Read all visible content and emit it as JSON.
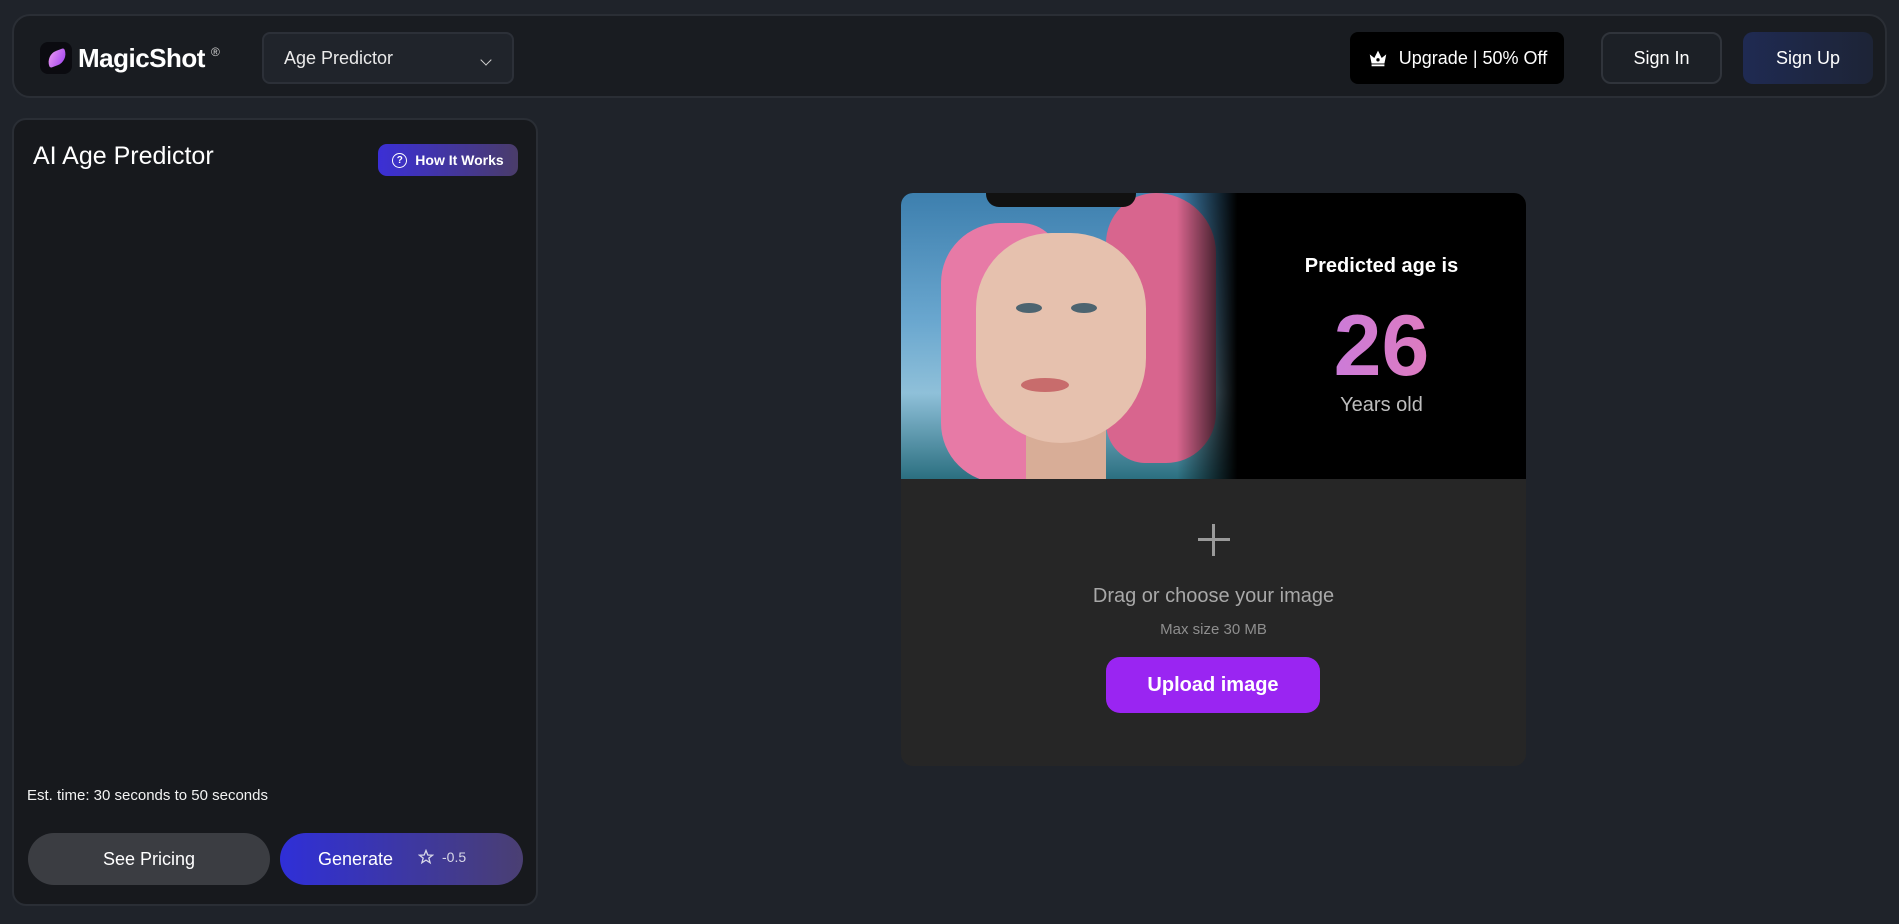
{
  "header": {
    "logo_text": "MagicShot",
    "logo_reg": "®",
    "tool_select_value": "Age Predictor",
    "upgrade_label": "Upgrade | 50% Off",
    "sign_in_label": "Sign In",
    "sign_up_label": "Sign Up"
  },
  "left_panel": {
    "title": "AI Age Predictor",
    "how_it_works_label": "How It Works",
    "est_time": "Est. time: 30 seconds to 50 seconds",
    "see_pricing_label": "See Pricing",
    "generate_label": "Generate",
    "generate_cost": "-0.5"
  },
  "result": {
    "predicted_label": "Predicted age is",
    "age_value": "26",
    "age_unit": "Years old"
  },
  "upload": {
    "drag_text": "Drag or choose your image",
    "max_size": "Max size 30 MB",
    "upload_label": "Upload image"
  },
  "icons": [
    "magicshot-logo-icon",
    "chevron-down-icon",
    "crown-icon",
    "question-icon",
    "credit-star-icon",
    "plus-icon"
  ],
  "colors": {
    "background": "#1f232a",
    "upload_button": "#9a25f2",
    "generate_gradient_start": "#2f2fd8",
    "age_gradient_start": "#b97cf2",
    "age_gradient_end": "#f07aa6"
  }
}
